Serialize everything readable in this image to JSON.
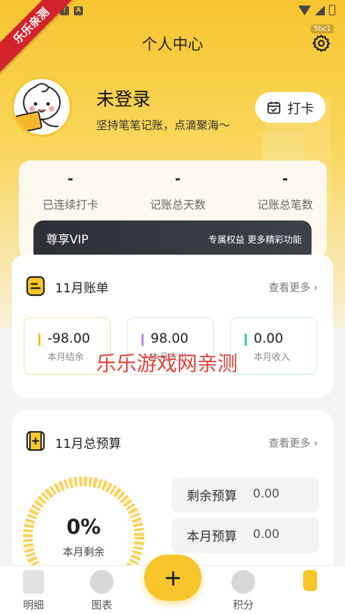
{
  "ribbon": "乐乐亲测",
  "build_tag": "5bc1",
  "header": {
    "title": "个人中心"
  },
  "user": {
    "name": "未登录",
    "slogan": "坚持笔笔记账，点滴聚海～",
    "checkin_label": "打卡"
  },
  "stats": [
    {
      "value": "-",
      "label": "已连续打卡"
    },
    {
      "value": "-",
      "label": "记账总天数"
    },
    {
      "value": "-",
      "label": "记账总笔数"
    }
  ],
  "vip": {
    "title": "尊享VIP",
    "desc": "专属权益 更多精彩功能"
  },
  "bill": {
    "title": "11月账单",
    "more": "查看更多",
    "items": [
      {
        "value": "-98.00",
        "label": "本月结余",
        "color": "#f3c21f"
      },
      {
        "value": "98.00",
        "label": "本月支出",
        "color": "#b98ae6"
      },
      {
        "value": "0.00",
        "label": "本月收入",
        "color": "#2fcfa8"
      }
    ]
  },
  "watermark": "乐乐游戏网亲测",
  "budget": {
    "title": "11月总预算",
    "more": "查看更多",
    "percent": "0%",
    "percent_label": "本月剩余",
    "rows": [
      {
        "label": "剩余预算",
        "value": "0.00"
      },
      {
        "label": "本月预算",
        "value": "0.00"
      }
    ]
  },
  "tabbar": {
    "items": [
      {
        "label": "明细",
        "icon": "ledger-icon"
      },
      {
        "label": "图表",
        "icon": "chart-icon"
      },
      {
        "label": "",
        "icon": "add-icon"
      },
      {
        "label": "积分",
        "icon": "star-icon"
      },
      {
        "label": "",
        "icon": "profile-icon"
      }
    ]
  },
  "colors": {
    "accent": "#f8c52a",
    "vip_bg": "#2e3037"
  }
}
